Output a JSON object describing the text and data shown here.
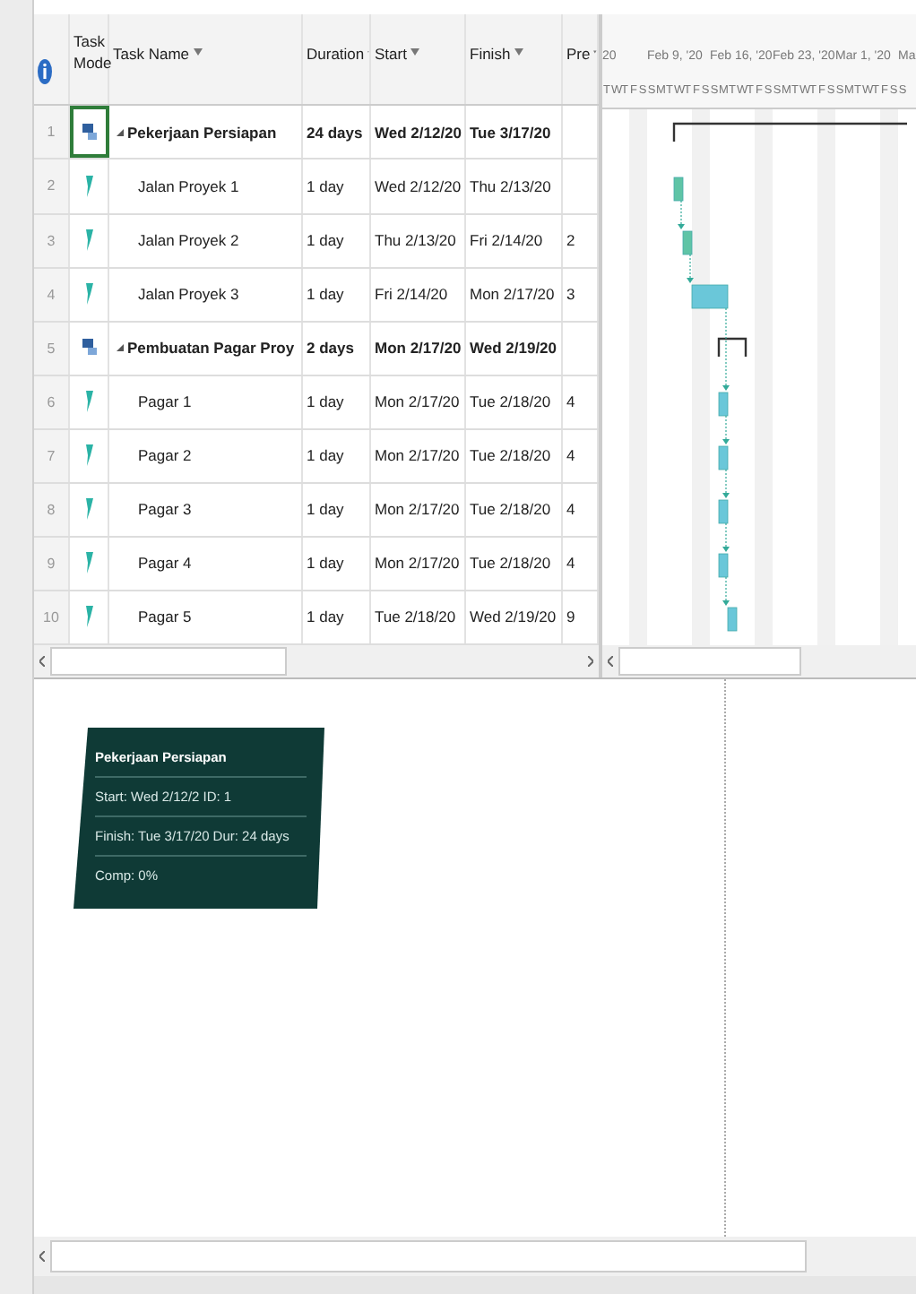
{
  "columns": [
    {
      "label": "Task Mode",
      "kind": "mode"
    },
    {
      "label": "Task Name",
      "kind": "name"
    },
    {
      "label": "Duration",
      "kind": "duration"
    },
    {
      "label": "Start",
      "kind": "start"
    },
    {
      "label": "Finish",
      "kind": "finish"
    },
    {
      "label": "Pre",
      "kind": "pred"
    }
  ],
  "timescale": {
    "weeks": [
      "20",
      "Feb 9, '20",
      "Feb 16, '20",
      "Feb 23, '20",
      "Mar 1, '20",
      "Ma"
    ],
    "days": [
      "T",
      "W",
      "T",
      "F",
      "S",
      "S",
      "M",
      "T",
      "W",
      "T",
      "F",
      "S",
      "S",
      "M",
      "T",
      "W",
      "T",
      "F",
      "S",
      "S",
      "M",
      "T",
      "W",
      "T",
      "F",
      "S",
      "S",
      "M",
      "T",
      "W",
      "T",
      "F",
      "S",
      "S"
    ]
  },
  "tasks": [
    {
      "id": "1",
      "kind": "auto",
      "name": "Pekerjaan Persiapan",
      "duration": "24 days",
      "start": "Wed 2/12/20",
      "finish": "Tue 3/17/20",
      "selected": true,
      "expanded": true,
      "children": [
        {
          "id": "2",
          "kind": "manual",
          "name": "Jalan Proyek 1",
          "duration": "1 day",
          "start": "Wed 2/12/20",
          "finish": "Thu 2/13/20",
          "selected": false
        },
        {
          "id": "3",
          "kind": "manual",
          "name": "Jalan Proyek 2",
          "duration": "1 day",
          "start": "Thu 2/13/20",
          "finish": "Fri 2/14/20",
          "pred": "2",
          "selected": false
        },
        {
          "id": "4",
          "kind": "manual",
          "name": "Jalan Proyek 3",
          "duration": "1 day",
          "start": "Fri 2/14/20",
          "finish": "Mon 2/17/20",
          "pred": "3",
          "selected": false
        }
      ]
    },
    {
      "id": "5",
      "kind": "auto",
      "name": "Pembuatan Pagar Proy",
      "duration": "2 days",
      "start": "Mon 2/17/20",
      "finish": "Wed 2/19/20",
      "selected": false,
      "expanded": true,
      "children": [
        {
          "id": "6",
          "kind": "manual",
          "name": "Pagar 1",
          "duration": "1 day",
          "start": "Mon 2/17/20",
          "finish": "Tue 2/18/20",
          "pred": "4",
          "selected": false
        },
        {
          "id": "7",
          "kind": "manual",
          "name": "Pagar 2",
          "duration": "1 day",
          "start": "Mon 2/17/20",
          "finish": "Tue 2/18/20",
          "pred": "4",
          "selected": false
        },
        {
          "id": "8",
          "kind": "manual",
          "name": "Pagar 3",
          "duration": "1 day",
          "start": "Mon 2/17/20",
          "finish": "Tue 2/18/20",
          "pred": "4",
          "selected": false
        },
        {
          "id": "9",
          "kind": "manual",
          "name": "Pagar 4",
          "duration": "1 day",
          "start": "Mon 2/17/20",
          "finish": "Tue 2/18/20",
          "pred": "4",
          "selected": false
        },
        {
          "id": "10",
          "kind": "manual",
          "name": "Pagar 5",
          "duration": "1 day",
          "start": "Tue 2/18/20",
          "finish": "Wed 2/19/20",
          "pred": "9",
          "selected": false
        }
      ]
    }
  ],
  "tooltip": {
    "title": "Pekerjaan Persiapan",
    "lines": [
      [
        "Start: Wed 2/12/2",
        "ID: 1"
      ],
      [
        "Finish: Tue 3/17/20",
        "Dur: 24 days"
      ],
      [
        "Comp: 0%"
      ]
    ]
  }
}
